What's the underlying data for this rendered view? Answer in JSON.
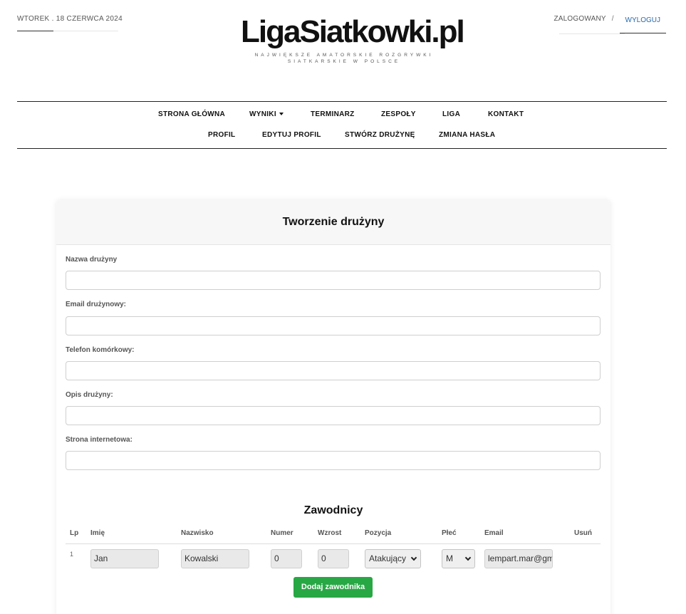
{
  "header": {
    "date": "WTOREK . 18 CZERWCA 2024",
    "logo_title": "LigaSiatkowki.pl",
    "logo_subtitle": "NAJWIĘKSZE AMATORSKIE ROZGRYWKI SIATKARSKIE W POLSCE",
    "logged_in": "ZALOGOWANY",
    "separator": "/",
    "logout": "WYLOGUJ"
  },
  "nav": {
    "row1": [
      "STRONA GŁÓWNA",
      "WYNIKI",
      "TERMINARZ",
      "ZESPOŁY",
      "LIGA",
      "KONTAKT"
    ],
    "row2": [
      "PROFIL",
      "EDYTUJ PROFIL",
      "STWÓRZ DRUŻYNĘ",
      "ZMIANA HASŁA"
    ]
  },
  "form": {
    "title": "Tworzenie drużyny",
    "fields": [
      {
        "label": "Nazwa drużyny",
        "value": ""
      },
      {
        "label": "Email drużynowy:",
        "value": ""
      },
      {
        "label": "Telefon komórkowy:",
        "value": ""
      },
      {
        "label": "Opis drużyny:",
        "value": ""
      },
      {
        "label": "Strona internetowa:",
        "value": ""
      }
    ]
  },
  "players": {
    "title": "Zawodnicy",
    "columns": [
      "Lp",
      "Imię",
      "Nazwisko",
      "Numer",
      "Wzrost",
      "Pozycja",
      "Płeć",
      "Email",
      "Usuń"
    ],
    "rows": [
      {
        "lp": "1",
        "first_name": "Jan",
        "last_name": "Kowalski",
        "number": "0",
        "height": "0",
        "position": "Atakujący",
        "gender": "M",
        "email": "lempart.mar@gm"
      }
    ],
    "add_button": "Dodaj zawodnika"
  },
  "colors": {
    "link": "#2a6aad",
    "add_button": "#28a745"
  }
}
